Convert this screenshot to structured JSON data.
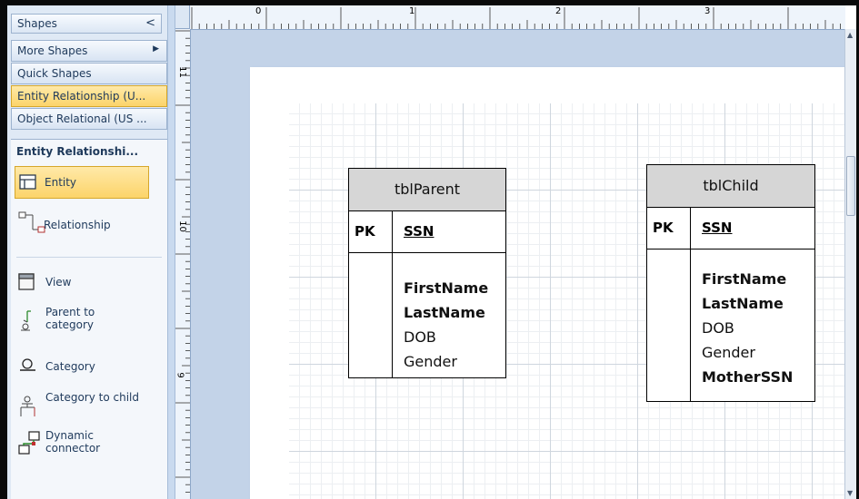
{
  "shapes_pane": {
    "header": "Shapes",
    "header_arrow": "<",
    "stencils": [
      {
        "label": "More Shapes",
        "arrow": "▶"
      },
      {
        "label": "Quick Shapes",
        "arrow": ""
      },
      {
        "label": "Entity Relationship (U...",
        "arrow": ""
      },
      {
        "label": "Object Relational (US ...",
        "arrow": ""
      }
    ],
    "active_stencil_title": "Entity Relationshi...",
    "shapes": [
      {
        "label": "Entity",
        "icon": "entity-icon"
      },
      {
        "label": "Relationship",
        "icon": "relationship-icon"
      },
      {
        "label": "View",
        "icon": "view-icon"
      },
      {
        "label": "Parent to category",
        "icon": "parent-to-category-icon"
      },
      {
        "label": "Category",
        "icon": "category-icon"
      },
      {
        "label": "Category to child",
        "icon": "category-to-child-icon"
      },
      {
        "label": "Dynamic connector",
        "icon": "dynamic-connector-icon"
      }
    ]
  },
  "rulers": {
    "horizontal_labels": [
      "0",
      "1",
      "2",
      "3"
    ],
    "vertical_labels": [
      "11",
      "10",
      "9"
    ]
  },
  "diagram": {
    "entities": [
      {
        "name": "tblParent",
        "pk_label": "PK",
        "pk_field": "SSN",
        "attributes": [
          {
            "name": "FirstName",
            "bold": true
          },
          {
            "name": "LastName",
            "bold": true
          },
          {
            "name": "DOB",
            "bold": false
          },
          {
            "name": "Gender",
            "bold": false
          }
        ]
      },
      {
        "name": "tblChild",
        "pk_label": "PK",
        "pk_field": "SSN",
        "attributes": [
          {
            "name": "FirstName",
            "bold": true
          },
          {
            "name": "LastName",
            "bold": true
          },
          {
            "name": "DOB",
            "bold": false
          },
          {
            "name": "Gender",
            "bold": false
          },
          {
            "name": "MotherSSN",
            "bold": true
          }
        ]
      }
    ]
  },
  "colors": {
    "pane_bg": "#dfe9f5",
    "active_highlight": "#fcd46a",
    "canvas_bg": "#c3d3e8",
    "entity_header": "#d6d6d6"
  }
}
